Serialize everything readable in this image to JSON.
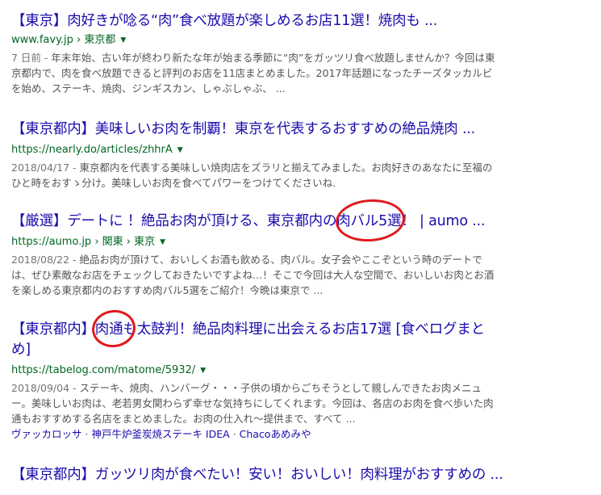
{
  "results": [
    {
      "title": "【東京】肉好きが唸る“肉”食べ放題が楽しめるお店11選！焼肉も ...",
      "url": "www.favy.jp › 東京都",
      "date": "7 日前 - ",
      "snippet": "年末年始、古い年が終わり新たな年が始まる季節に“肉”をガッツリ食べ放題しませんか？今回は東京都内で、肉を食べ放題できると評判のお店を11店まとめました。2017年話題になったチーズタッカルビを始め、ステーキ、焼肉、ジンギスカン、しゃぶしゃぶ、 ..."
    },
    {
      "title": "【東京都内】美味しいお肉を制覇！東京を代表するおすすめの絶品焼肉 ...",
      "url": "https://nearly.do/articles/zhhrA",
      "date": "2018/04/17 - ",
      "snippet": "東京都内を代表する美味しい焼肉店をズラリと揃えてみました。お肉好きのあなたに至福のひと時をおすゝ分け。美味しいお肉を食べてパワーをつけてくださいね."
    },
    {
      "title": "【厳選】デートに ！絶品お肉が頂ける、東京都内の肉バル5選！ | aumo ...",
      "url": "https://aumo.jp › 関東 › 東京",
      "date": "2018/08/22 - ",
      "snippet": "絶品お肉が頂けて、おいしくお酒も飲める、肉バル。女子会やここぞという時のデートでは、ぜひ素敵なお店をチェックしておきたいですよね…！そこで今回は大人な空間で、おいしいお肉とお酒を楽しめる東京都内のおすすめ肉バル5選をご紹介！今晩は東京で ..."
    },
    {
      "title": "【東京都内】肉通も太鼓判！絶品肉料理に出会えるお店17選 [食べログまとめ]",
      "url": "https://tabelog.com/matome/5932/",
      "date": "2018/09/04 - ",
      "snippet": "ステーキ、焼肉、ハンバーグ・・・子供の頃からごちそうとして親しんできたお肉メニュー。美味しいお肉は、老若男女関わらず幸せな気持ちにしてくれます。今回は、各店のお肉を食べ歩いた肉通もおすすめする名店をまとめました。お肉の仕入れ～提供まで、すべて ...",
      "sitelinks": [
        "ヴァッカロッサ",
        "神戸牛炉釜炭焼ステーキ IDEA",
        "Chacoあめみや"
      ]
    },
    {
      "title": "【東京都内】ガッツリ肉が食べたい！安い！おいしい！肉料理がおすすめの ..."
    }
  ],
  "accent": {
    "link": "#1a0dab",
    "url": "#006621",
    "snippet": "#545454",
    "annotation": "#e0191e"
  }
}
